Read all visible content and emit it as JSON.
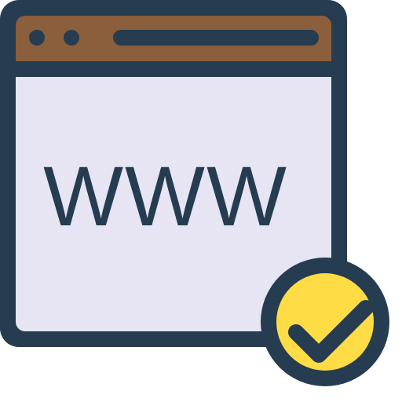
{
  "icon": {
    "name": "website-verified-icon",
    "parts": {
      "browser_window": "browser-window-icon",
      "title_bar_dots": "window-dots-icon",
      "address_bar": "address-bar-icon",
      "badge": "checkmark-badge-icon"
    }
  },
  "window": {
    "text": "WWW"
  },
  "colors": {
    "outline": "#263C51",
    "title_bar": "#8B5E3C",
    "window_body": "#E7E5F3",
    "badge_fill": "#FDDC45",
    "background": "#FFFFFF"
  }
}
